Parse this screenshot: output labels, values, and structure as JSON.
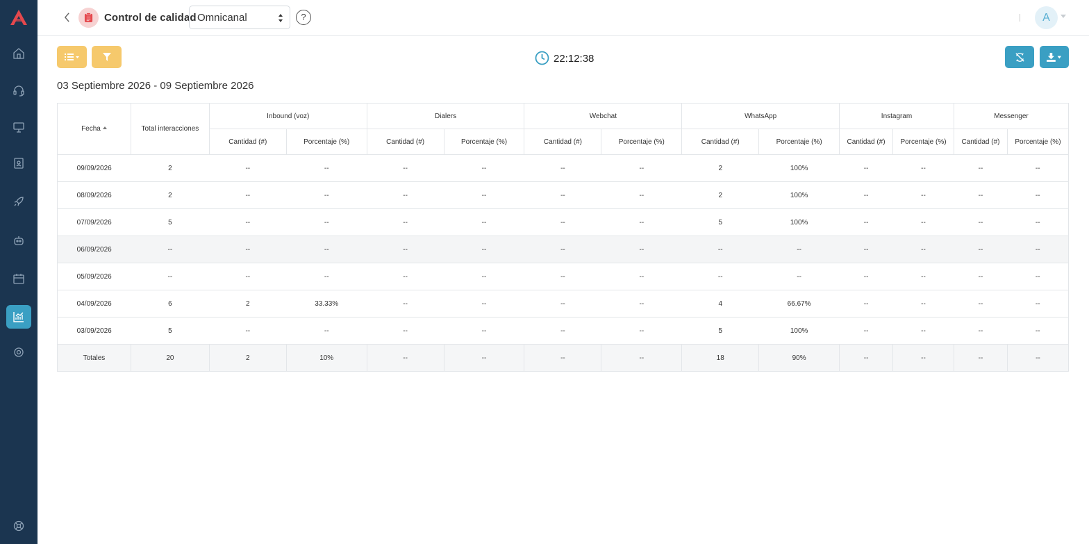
{
  "header": {
    "title": "Control de calidad",
    "channel_select": {
      "value": "Omnicanal"
    },
    "help": "?",
    "avatar_initial": "A"
  },
  "toolbar": {
    "time": "22:12:38"
  },
  "date_range": "03 Septiembre 2026 - 09 Septiembre 2026",
  "sidebar": {
    "items": [
      {
        "icon": "home-icon"
      },
      {
        "icon": "headset-icon"
      },
      {
        "icon": "monitor-icon"
      },
      {
        "icon": "contacts-icon"
      },
      {
        "icon": "rocket-icon"
      },
      {
        "icon": "bot-icon"
      },
      {
        "icon": "calendar-icon"
      },
      {
        "icon": "chart-icon",
        "active": true
      },
      {
        "icon": "gear-icon"
      },
      {
        "icon": "lifebuoy-icon"
      }
    ],
    "accent": "#3a9fc3",
    "background": "#1b3550"
  },
  "table": {
    "date_header": "Fecha",
    "total_header": "Total interacciones",
    "groups": [
      "Inbound (voz)",
      "Dialers",
      "Webchat",
      "WhatsApp",
      "Instagram",
      "Messenger"
    ],
    "sub_headers": [
      "Cantidad (#)",
      "Porcentaje (%)"
    ],
    "rows": [
      [
        "09/09/2026",
        "2",
        "--",
        "--",
        "--",
        "--",
        "--",
        "--",
        "2",
        "100%",
        "--",
        "--",
        "--",
        "--"
      ],
      [
        "08/09/2026",
        "2",
        "--",
        "--",
        "--",
        "--",
        "--",
        "--",
        "2",
        "100%",
        "--",
        "--",
        "--",
        "--"
      ],
      [
        "07/09/2026",
        "5",
        "--",
        "--",
        "--",
        "--",
        "--",
        "--",
        "5",
        "100%",
        "--",
        "--",
        "--",
        "--"
      ],
      [
        "06/09/2026",
        "--",
        "--",
        "--",
        "--",
        "--",
        "--",
        "--",
        "--",
        "--",
        "--",
        "--",
        "--",
        "--"
      ],
      [
        "05/09/2026",
        "--",
        "--",
        "--",
        "--",
        "--",
        "--",
        "--",
        "--",
        "--",
        "--",
        "--",
        "--",
        "--"
      ],
      [
        "04/09/2026",
        "6",
        "2",
        "33.33%",
        "--",
        "--",
        "--",
        "--",
        "4",
        "66.67%",
        "--",
        "--",
        "--",
        "--"
      ],
      [
        "03/09/2026",
        "5",
        "--",
        "--",
        "--",
        "--",
        "--",
        "--",
        "5",
        "100%",
        "--",
        "--",
        "--",
        "--"
      ]
    ],
    "totals": [
      "Totales",
      "20",
      "2",
      "10%",
      "--",
      "--",
      "--",
      "--",
      "18",
      "90%",
      "--",
      "--",
      "--",
      "--"
    ]
  },
  "colors": {
    "primary_yellow": "#f6c96c",
    "primary_blue": "#3a9fc3",
    "logo_red": "#e5484d"
  }
}
